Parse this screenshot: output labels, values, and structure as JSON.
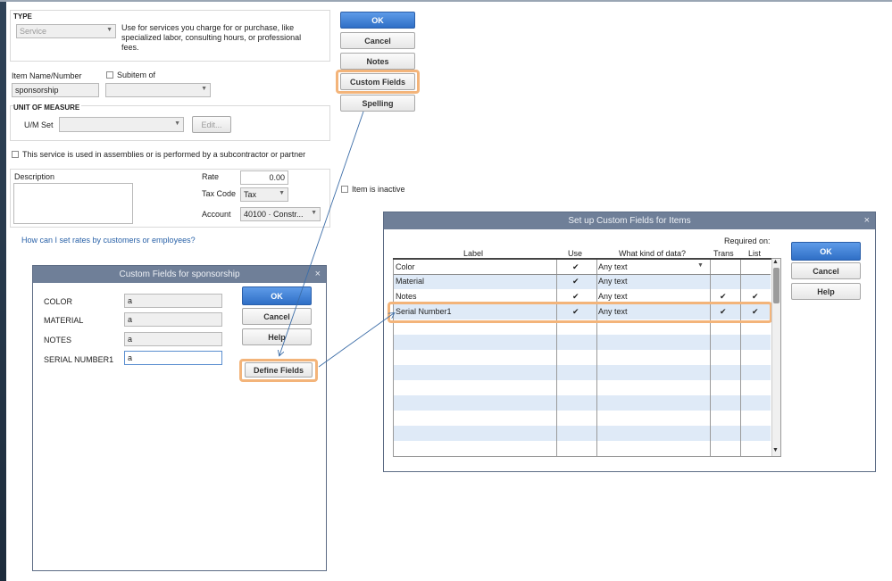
{
  "item_form": {
    "type_heading": "TYPE",
    "type_value": "Service",
    "type_description": "Use for services you charge for or purchase, like specialized labor, consulting hours, or professional fees.",
    "item_name_label": "Item Name/Number",
    "item_name_value": "sponsorship",
    "subitem_label": "Subitem of",
    "unit_heading": "UNIT OF MEASURE",
    "um_set_label": "U/M Set",
    "edit_label": "Edit...",
    "assemblies_label": "This service is used in assemblies or is performed by a subcontractor or partner",
    "description_label": "Description",
    "rate_label": "Rate",
    "rate_value": "0.00",
    "tax_code_label": "Tax Code",
    "tax_code_value": "Tax",
    "account_label": "Account",
    "account_value": "40100 · Constr...",
    "inactive_label": "Item is inactive",
    "help_link": "How can I set rates by customers or employees?",
    "buttons": {
      "ok": "OK",
      "cancel": "Cancel",
      "notes": "Notes",
      "custom_fields": "Custom Fields",
      "spelling": "Spelling"
    }
  },
  "custom_fields_dialog": {
    "title": "Custom Fields for sponsorship",
    "fields": [
      {
        "label": "COLOR",
        "value": "a"
      },
      {
        "label": "MATERIAL",
        "value": "a"
      },
      {
        "label": "NOTES",
        "value": "a"
      },
      {
        "label": "SERIAL NUMBER1",
        "value": "a"
      }
    ],
    "buttons": {
      "ok": "OK",
      "cancel": "Cancel",
      "help": "Help",
      "define_fields": "Define Fields"
    }
  },
  "setup_dialog": {
    "title": "Set up Custom Fields for Items",
    "required_on": "Required on:",
    "columns": {
      "label": "Label",
      "use": "Use",
      "kind": "What kind of data?",
      "trans": "Trans",
      "list": "List"
    },
    "rows": [
      {
        "label": "Color",
        "use": "✔",
        "kind": "Any text",
        "trans": "",
        "list": ""
      },
      {
        "label": "Material",
        "use": "✔",
        "kind": "Any text",
        "trans": "",
        "list": ""
      },
      {
        "label": "Notes",
        "use": "✔",
        "kind": "Any text",
        "trans": "✔",
        "list": "✔"
      },
      {
        "label": "Serial Number1",
        "use": "✔",
        "kind": "Any text",
        "trans": "✔",
        "list": "✔"
      }
    ],
    "buttons": {
      "ok": "OK",
      "cancel": "Cancel",
      "help": "Help"
    }
  },
  "colors": {
    "highlight": "#f3b47a",
    "title_bar": "#6f7f98",
    "primary_button": "#3f7fd6",
    "link": "#2a62a8",
    "row_stripe": "#dfeaf7"
  }
}
